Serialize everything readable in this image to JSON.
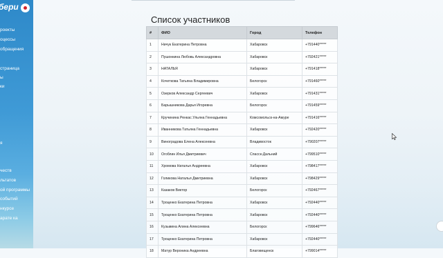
{
  "sidebar": {
    "brand": "бери",
    "items": [
      "роекты",
      "оцессы",
      "обращения",
      "страница",
      "ы",
      "ки",
      "я",
      "честв",
      "льтатов",
      "ой программы",
      "событий",
      "нкурсе",
      "арате ка"
    ]
  },
  "main": {
    "title": "Список участников",
    "columns": [
      "#",
      "ФИО",
      "Город",
      "Телефон"
    ],
    "rows": [
      [
        "1",
        "Ничук Екатерина Петровна",
        "Хабаровск",
        "+791440*****"
      ],
      [
        "2",
        "Пушонкина Любовь Александровна",
        "Хабаровск",
        "+792421*****"
      ],
      [
        "3",
        "НАТАЛЬЯ",
        "Хабаровск",
        "+791418*****"
      ],
      [
        "4",
        "Кочеткова Татьяна Владимировна",
        "Белогорск",
        "+791460*****"
      ],
      [
        "5",
        "Озерков Александр Сергеевич",
        "Хабаровск",
        "+791431*****"
      ],
      [
        "6",
        "Барышникова Дарья Игоревна",
        "Белогорск",
        "+791459*****"
      ],
      [
        "7",
        "Кручинина Ренкас Ульяна Геннадьевна",
        "Комсомольск-на-Амуре",
        "+791416*****"
      ],
      [
        "8",
        "Иванникова Татьяна Геннадьевна",
        "Хабаровск",
        "+792420*****"
      ],
      [
        "9",
        "Виноградова Елена Алексеевна",
        "Владивосток",
        "+790207*****"
      ],
      [
        "10",
        "Огоблин Илья Дмитриевич",
        "Спасск-Дальний",
        "+799510*****"
      ],
      [
        "11",
        "Хромова Наталья Андреевна",
        "Хабаровск",
        "+798417*****"
      ],
      [
        "12",
        "Голикова Наталья Дмитриевна",
        "Хабаровск",
        "+798429*****"
      ],
      [
        "13",
        "Казаков Виктор",
        "Белогорск",
        "+792467*****"
      ],
      [
        "14",
        "Троценко Екатерина Петровна",
        "Хабаровск",
        "+792440*****"
      ],
      [
        "15",
        "Троценко Екатерина Петровна",
        "Хабаровск",
        "+792440*****"
      ],
      [
        "16",
        "Кузьмина Алина Алексеевна",
        "Белогорск",
        "+799646*****"
      ],
      [
        "17",
        "Троценко Екатерина Петровна",
        "Хабаровск",
        "+792440*****"
      ],
      [
        "18",
        "Матур Вероника Андреевна",
        "Благовещенск",
        "+799014*****"
      ]
    ]
  },
  "colors": {
    "sidebar": "#2e89c9",
    "brand_logo": "#d2232a",
    "header_bg": "#d4d9dd"
  },
  "icons": {
    "cursor": "arrow-cursor-icon",
    "scroll": "scroll-up-icon"
  }
}
